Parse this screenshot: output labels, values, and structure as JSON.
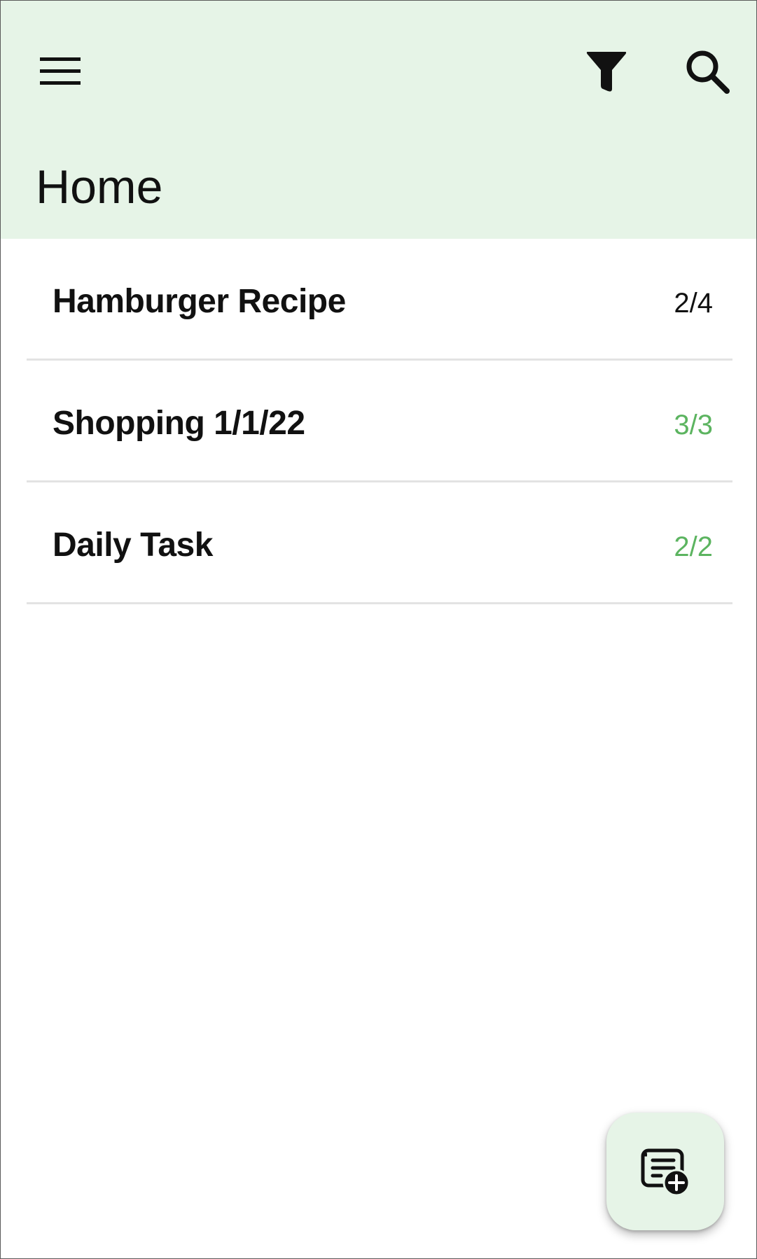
{
  "header": {
    "title": "Home",
    "menu_icon": "hamburger-menu-icon",
    "filter_icon": "filter-funnel-icon",
    "search_icon": "search-icon",
    "background_color": "#e6f4e7"
  },
  "lists": [
    {
      "title": "Hamburger Recipe",
      "progress": "2/4",
      "complete": false
    },
    {
      "title": "Shopping 1/1/22",
      "progress": "3/3",
      "complete": true
    },
    {
      "title": "Daily Task",
      "progress": "2/2",
      "complete": true
    }
  ],
  "colors": {
    "complete": "#5cb460",
    "incomplete": "#111111",
    "divider": "#e3e3e3"
  },
  "fab": {
    "icon": "add-list-icon"
  }
}
